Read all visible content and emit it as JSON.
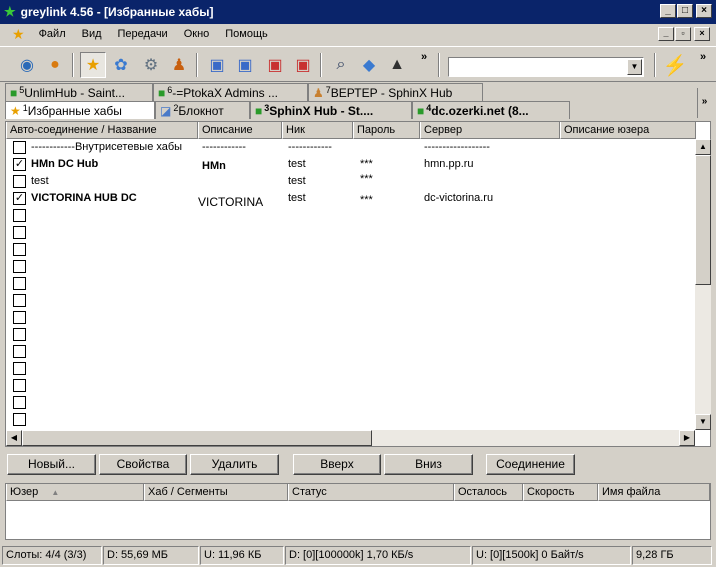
{
  "window": {
    "title": "greylink 4.56 - [Избранные хабы]",
    "min": "_",
    "max": "□",
    "close": "×"
  },
  "menu": {
    "items": [
      "Файл",
      "Вид",
      "Передачи",
      "Окно",
      "Помощь"
    ],
    "mdi_min": "_",
    "mdi_restore": "▫",
    "mdi_close": "×"
  },
  "toolbar": {
    "chevron": "»",
    "search_value": "",
    "bolt_icon": "lightning-icon"
  },
  "tabs_top": [
    {
      "num": "5",
      "label": "UnlimHub - Saint...",
      "icon": "cube-icon",
      "bold": false
    },
    {
      "num": "6",
      "label": "-=PtokaX Admins ...",
      "icon": "cube-icon",
      "bold": false
    },
    {
      "num": "7",
      "label": "ВЕРТЕР - SphinX Hub",
      "icon": "user-icon",
      "bold": false
    }
  ],
  "tabs_bottom": [
    {
      "num": "1",
      "label": "Избранные хабы",
      "icon": "star-icon",
      "bold": false,
      "active": true
    },
    {
      "num": "2",
      "label": "Блокнот",
      "icon": "notepad-icon",
      "bold": false
    },
    {
      "num": "3",
      "label": "SphinX Hub - St....",
      "icon": "cube-icon",
      "bold": true
    },
    {
      "num": "4",
      "label": "dc.ozerki.net (8...",
      "icon": "cube-icon",
      "bold": true
    }
  ],
  "tabs_scroll": "»",
  "table": {
    "columns": [
      "Авто-соединение / Название",
      "Описание",
      "Ник",
      "Пароль",
      "Сервер",
      "Описание юзера"
    ],
    "rows": [
      {
        "checked": false,
        "name": "------------Внутрисетевые хабы",
        "desc": "------------",
        "nick": "------------",
        "pass": "",
        "server": "------------------",
        "bold": false
      },
      {
        "checked": true,
        "name": "HMn DC Hub",
        "desc": "HMn",
        "nick": "test",
        "pass": "***",
        "server": "hmn.pp.ru",
        "bold": true
      },
      {
        "checked": false,
        "name": "test",
        "desc": "",
        "nick": "test",
        "pass": "***",
        "server": "",
        "bold": false
      },
      {
        "checked": true,
        "name": "VICTORINA HUB DC",
        "desc": "VICTORINA",
        "nick": "test",
        "pass": "***",
        "server": "dc-victorina.ru",
        "bold": true
      }
    ],
    "empty_rows": 14
  },
  "buttons": {
    "new": "Новый...",
    "props": "Свойства",
    "delete": "Удалить",
    "up": "Вверх",
    "down": "Вниз",
    "connect": "Соединение"
  },
  "transfers": {
    "columns": [
      "Юзер",
      "Хаб / Сегменты",
      "Статус",
      "Осталось",
      "Скорость",
      "Имя файла"
    ]
  },
  "status": {
    "slots": "Слоты: 4/4 (3/3)",
    "down": "D: 55,69 МБ",
    "up": "U: 11,96 КБ",
    "down_rate": "D: [0][100000k] 1,70 КБ/s",
    "up_rate": "U: [0][1500k] 0 Байт/s",
    "share": "9,28 ГБ"
  }
}
